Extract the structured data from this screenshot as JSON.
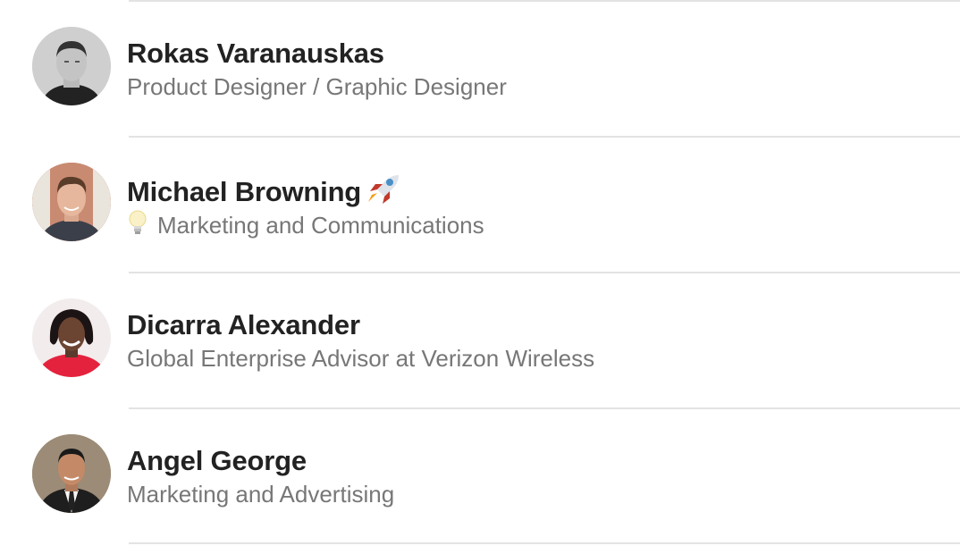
{
  "people": [
    {
      "name": "Rokas Varanauskas",
      "title": "Product Designer / Graphic Designer",
      "avatar_icon": "person-photo-avatar"
    },
    {
      "name": "Michael Browning",
      "name_emoji_icon": "rocket-icon",
      "title": "Marketing and Communications",
      "title_emoji_icon": "lightbulb-icon",
      "avatar_icon": "person-photo-avatar"
    },
    {
      "name": "Dicarra Alexander",
      "title": "Global Enterprise Advisor at Verizon Wireless",
      "avatar_icon": "person-photo-avatar"
    },
    {
      "name": "Angel George",
      "title": "Marketing and Advertising",
      "avatar_icon": "person-photo-avatar"
    }
  ],
  "colors": {
    "name": "#222222",
    "title": "#777777",
    "divider": "#e3e3e3"
  }
}
